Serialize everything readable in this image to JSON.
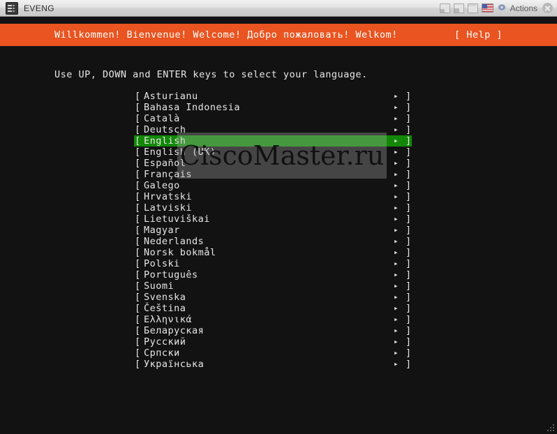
{
  "window": {
    "title": "EVENG",
    "app_icon": "terminal-icon",
    "controls": {
      "minimize": "minimize-icon",
      "maximize": "maximize-icon",
      "restore": "restore-icon",
      "keyboard_layout": "us-flag-icon",
      "gear": "gear-icon",
      "actions_label": "Actions",
      "close": "close-icon"
    }
  },
  "banner": {
    "greeting": "Willkommen! Bienvenue! Welcome! Добро пожаловать! Welkom!",
    "help": "[ Help ]",
    "background_color": "#e95420",
    "text_color": "#ffffff"
  },
  "instruction": "Use UP, DOWN and ENTER keys to select your language.",
  "list": {
    "bracket_open": "[",
    "bracket_close": "]",
    "arrow": "▸",
    "selected_index": 4,
    "highlight_color": "#138808",
    "items": [
      {
        "label": "Asturianu"
      },
      {
        "label": "Bahasa Indonesia"
      },
      {
        "label": "Català"
      },
      {
        "label": "Deutsch"
      },
      {
        "label": "English"
      },
      {
        "label": "English (UK)"
      },
      {
        "label": "Español"
      },
      {
        "label": "Français"
      },
      {
        "label": "Galego"
      },
      {
        "label": "Hrvatski"
      },
      {
        "label": "Latviski"
      },
      {
        "label": "Lietuviškai"
      },
      {
        "label": "Magyar"
      },
      {
        "label": "Nederlands"
      },
      {
        "label": "Norsk bokmål"
      },
      {
        "label": "Polski"
      },
      {
        "label": "Português"
      },
      {
        "label": "Suomi"
      },
      {
        "label": "Svenska"
      },
      {
        "label": "Čeština"
      },
      {
        "label": "Ελληνικά"
      },
      {
        "label": "Беларуская"
      },
      {
        "label": "Русский"
      },
      {
        "label": "Српски"
      },
      {
        "label": "Українська"
      }
    ]
  },
  "watermark": {
    "text": "CiscoMaster.ru"
  },
  "terminal": {
    "background_color": "#121212",
    "foreground_color": "#e6e6e6"
  }
}
